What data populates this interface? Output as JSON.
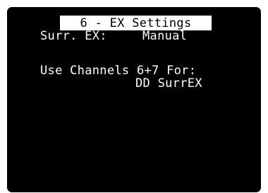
{
  "menu": {
    "title": "6 - EX Settings",
    "surr_ex_label": "Surr. EX:",
    "surr_ex_value": "Manual",
    "channels_label": "Use Channels 6+7 For:",
    "channels_value": "DD SurrEX"
  },
  "colors": {
    "screen_background": "#000000",
    "text": "#ffffff",
    "title_background": "#ffffff",
    "title_text": "#000000"
  }
}
